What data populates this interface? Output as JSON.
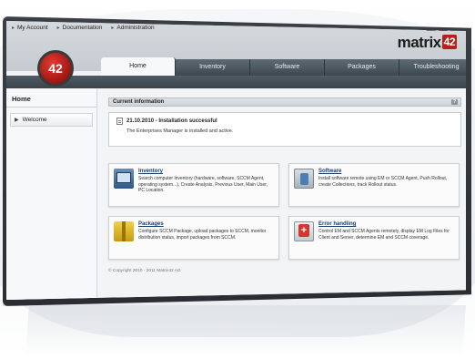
{
  "topnav": [
    {
      "label": "My Account"
    },
    {
      "label": "Documentation"
    },
    {
      "label": "Administration"
    }
  ],
  "window_controls": {
    "minimize": "–",
    "maximize": "□",
    "close": "×"
  },
  "brand": {
    "name": "matrix",
    "number": "42"
  },
  "logo": {
    "text": "42"
  },
  "tabs": [
    "Home",
    "Inventory",
    "Software",
    "Packages",
    "Troubleshooting"
  ],
  "active_tab": "Home",
  "sidebar": {
    "title": "Home",
    "items": [
      {
        "label": "Welcome"
      }
    ]
  },
  "current_info": {
    "header": "Current information",
    "help": "?",
    "entry_title": "21.10.2010 - Installation successful",
    "entry_text": "The Enterprises Manager is installed and active."
  },
  "cards": [
    {
      "title": "Inventory",
      "icon": "computer-icon",
      "description": "Search computer inventory (hardware, software, SCCM Agent, operating system...), Create Analysis, Previous User, Main User, PC Location."
    },
    {
      "title": "Software",
      "icon": "software-icon",
      "description": "Install software remote using EM or SCCM Agent, Push Rollout, create Collections, track Rollout status."
    },
    {
      "title": "Packages",
      "icon": "package-icon",
      "description": "Configure SCCM Package, upload packages to SCCM, monitor distribution status, import packages from SCCM."
    },
    {
      "title": "Error handling",
      "icon": "first-aid-icon",
      "description": "Control EM and SCCM Agents remotely, display EM Log Files for Client and Server, determine EM and SCCM coverage."
    }
  ],
  "footer": "© Copyright 2010 - 2011 Matrix42 AG",
  "colors": {
    "accent_red": "#b2231b",
    "tab_dark": "#3d4852",
    "link_blue": "#1a3f6f"
  }
}
